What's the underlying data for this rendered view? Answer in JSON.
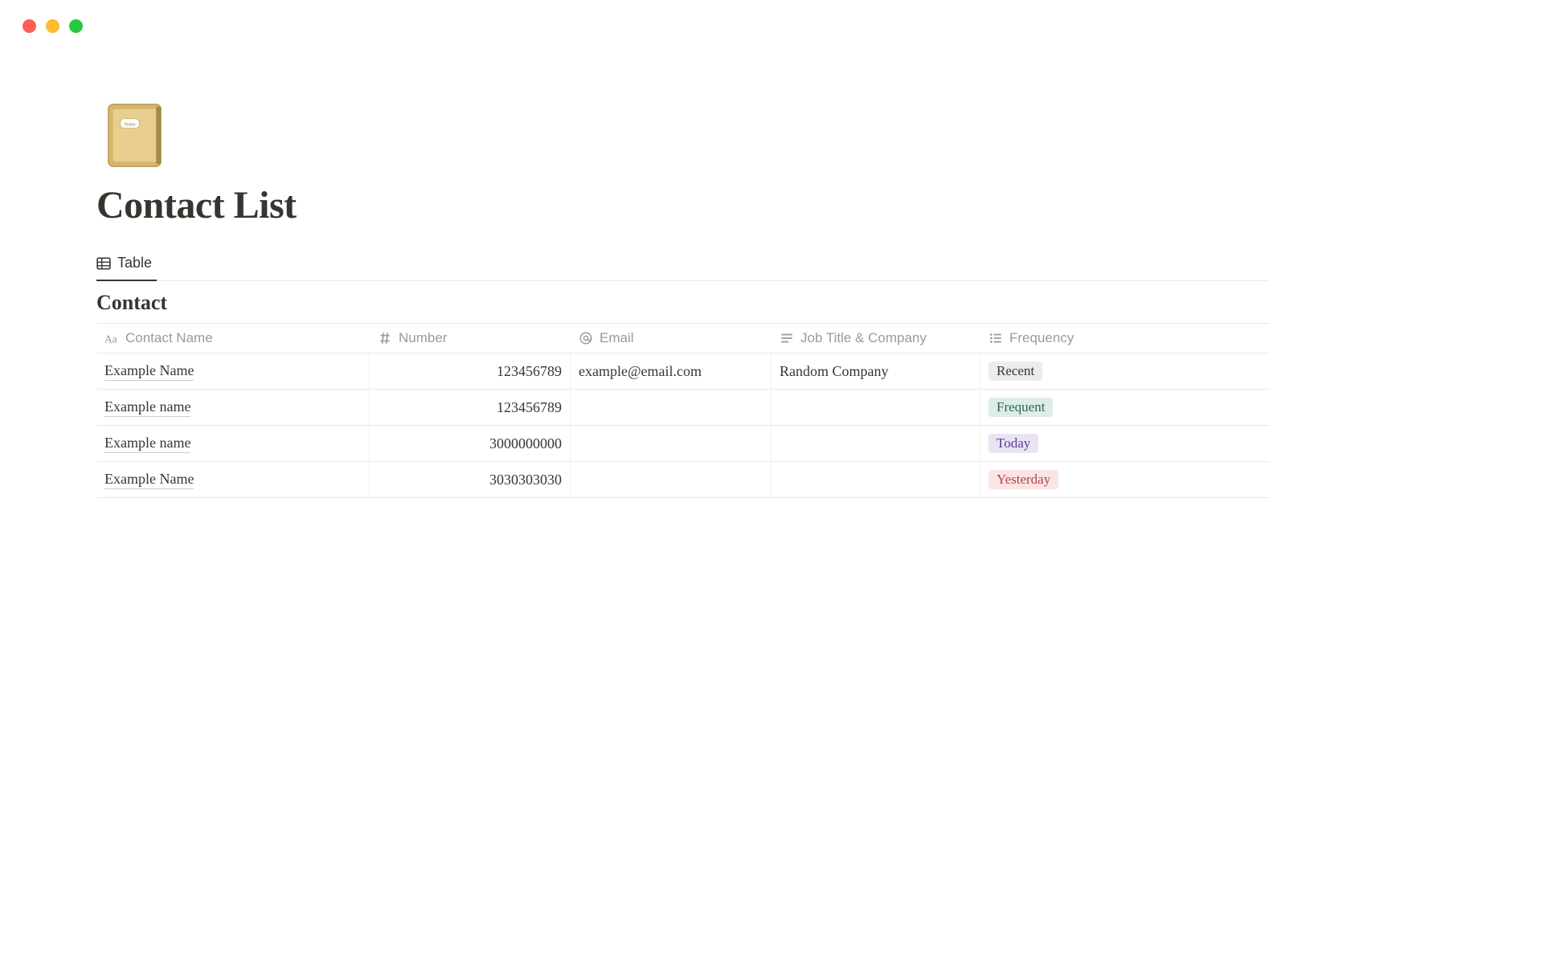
{
  "page": {
    "title": "Contact List",
    "icon_name": "notebook-icon",
    "section_title": "Contact"
  },
  "tabs": {
    "active": "Table"
  },
  "columns": [
    {
      "key": "name",
      "label": "Contact Name",
      "icon": "text-icon"
    },
    {
      "key": "number",
      "label": "Number",
      "icon": "hash-icon"
    },
    {
      "key": "email",
      "label": "Email",
      "icon": "at-icon"
    },
    {
      "key": "company",
      "label": "Job Title & Company",
      "icon": "lines-icon"
    },
    {
      "key": "frequency",
      "label": "Frequency",
      "icon": "list-icon"
    }
  ],
  "rows": [
    {
      "name": "Example Name",
      "number": "123456789",
      "email": "example@email.com",
      "company": "Random Company",
      "frequency": {
        "label": "Recent",
        "color": "gray"
      }
    },
    {
      "name": "Example name",
      "number": "123456789",
      "email": "",
      "company": "",
      "frequency": {
        "label": "Frequent",
        "color": "green"
      }
    },
    {
      "name": "Example name",
      "number": "3000000000",
      "email": "",
      "company": "",
      "frequency": {
        "label": "Today",
        "color": "purple"
      }
    },
    {
      "name": "Example Name",
      "number": "3030303030",
      "email": "",
      "company": "",
      "frequency": {
        "label": "Yesterday",
        "color": "red"
      }
    }
  ]
}
